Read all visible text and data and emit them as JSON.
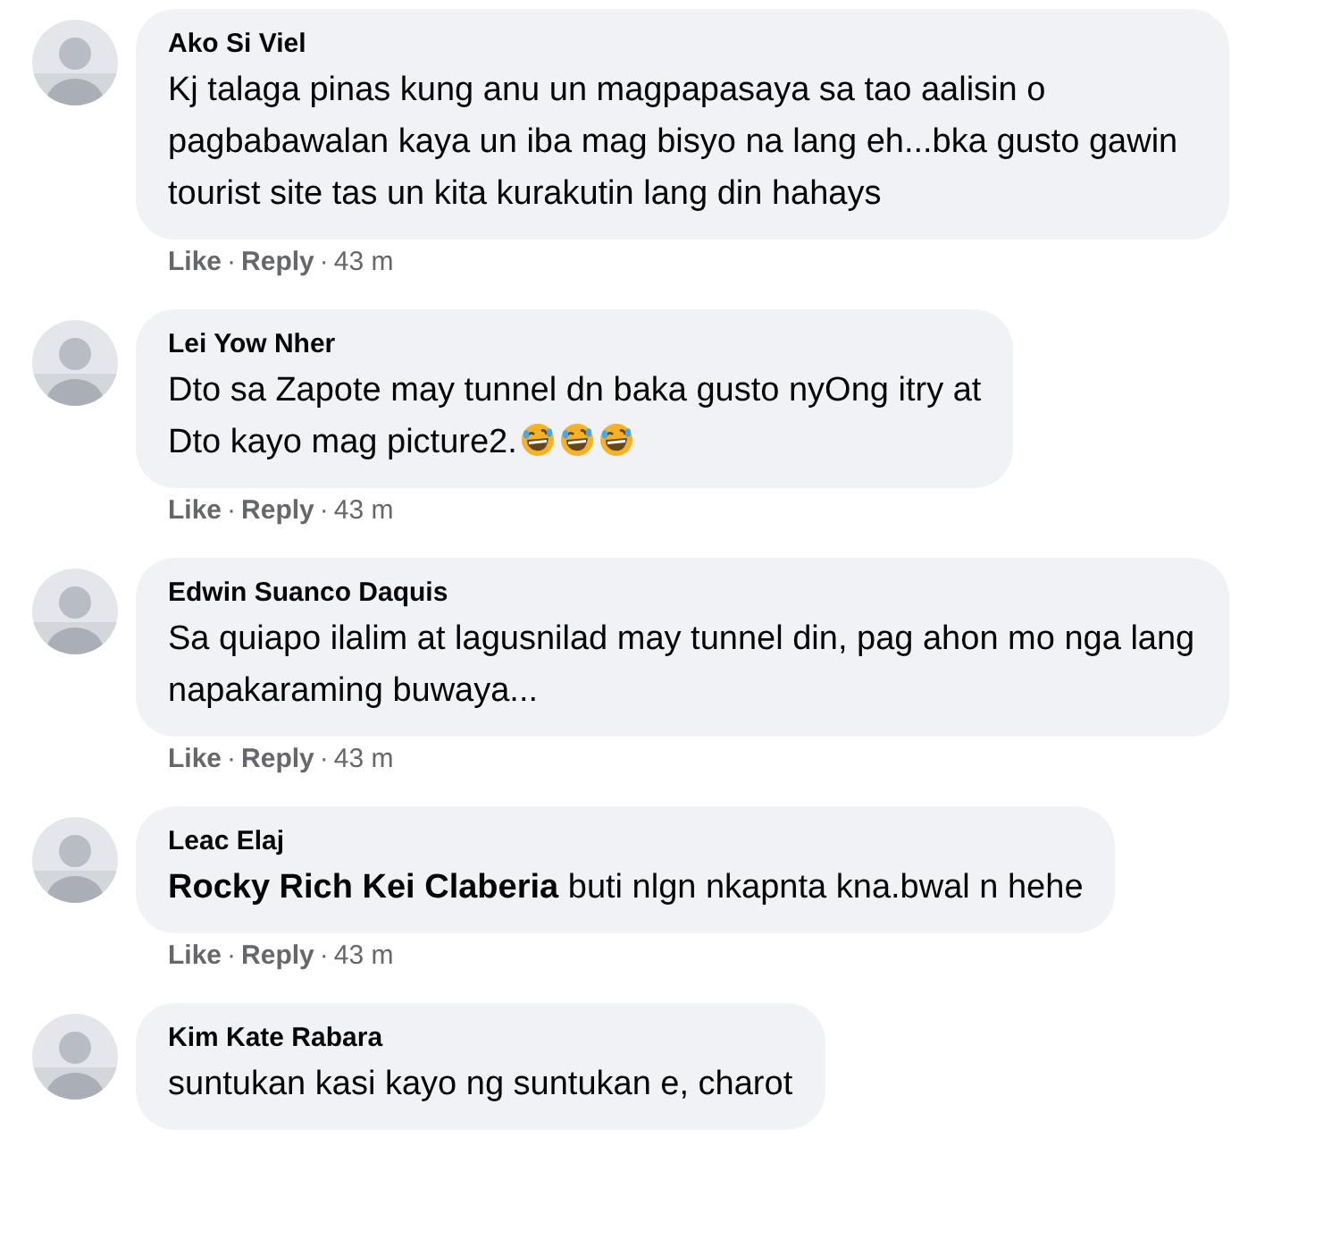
{
  "separator": "·",
  "comments": [
    {
      "author": "Ako Si Viel",
      "text": "Kj talaga pinas kung anu un magpapasaya sa tao aalisin o pagbabawalan kaya un iba mag bisyo na lang eh...bka gusto gawin tourist site tas un kita kurakutin lang din hahays",
      "actions": {
        "like": "Like",
        "reply": "Reply",
        "time": "43 m"
      }
    },
    {
      "author": "Lei Yow Nher",
      "lines": [
        "Dto sa Zapote may tunnel dn baka gusto nyOng itry at",
        "Dto kayo mag picture2."
      ],
      "emojis": [
        {
          "kind": "laughing"
        },
        {
          "kind": "laughing"
        },
        {
          "kind": "laughing"
        }
      ],
      "actions": {
        "like": "Like",
        "reply": "Reply",
        "time": "43 m"
      }
    },
    {
      "author": "Edwin Suanco Daquis",
      "text": "Sa quiapo ilalim at lagusnilad may tunnel din, pag ahon mo nga lang napakaraming buwaya...",
      "actions": {
        "like": "Like",
        "reply": "Reply",
        "time": "43 m"
      }
    },
    {
      "author": "Leac Elaj",
      "text": "**Rocky Rich Kei Claberia** buti nlgn nkapnta kna.bwal n hehe",
      "actions": {
        "like": "Like",
        "reply": "Reply",
        "time": "43 m"
      }
    },
    {
      "author": "Kim Kate Rabara",
      "text": "suntukan kasi kayo ng suntukan e, charot"
    }
  ]
}
